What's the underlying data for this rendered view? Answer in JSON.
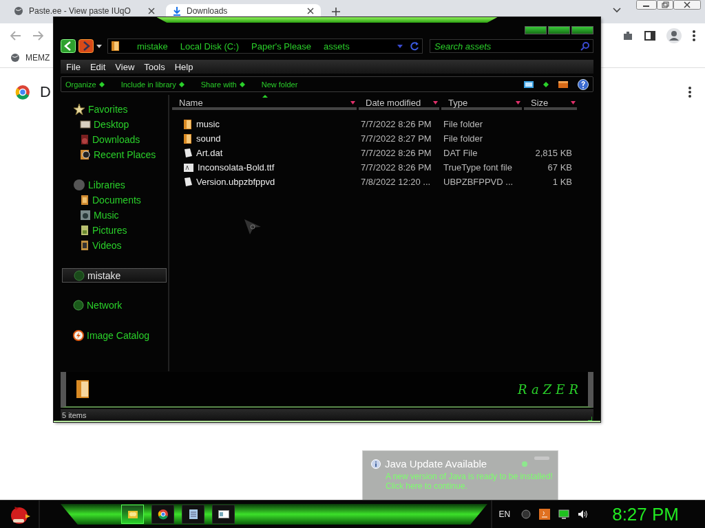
{
  "browser": {
    "tabs": [
      {
        "title": "Paste.ee - View paste IUqO",
        "selected": false
      },
      {
        "title": "Downloads",
        "selected": true
      }
    ],
    "bookmarks": [
      {
        "label": "MEMZ"
      }
    ],
    "page_heading": "D"
  },
  "explorer": {
    "breadcrumb": [
      "mistake",
      "Local Disk (C:)",
      "Paper's Please",
      "assets"
    ],
    "search": {
      "placeholder": "Search assets"
    },
    "menu": [
      "File",
      "Edit",
      "View",
      "Tools",
      "Help"
    ],
    "commands": [
      "Organize",
      "Include in library",
      "Share with",
      "New folder"
    ],
    "nav": [
      {
        "label": "Favorites",
        "kind": "favorites",
        "selected": false,
        "children": [
          {
            "label": "Desktop",
            "kind": "desktop",
            "selected": false
          },
          {
            "label": "Downloads",
            "kind": "downloads",
            "selected": false
          },
          {
            "label": "Recent Places",
            "kind": "recent",
            "selected": false
          }
        ]
      },
      {
        "label": "Libraries",
        "kind": "libraries",
        "selected": false,
        "children": [
          {
            "label": "Documents",
            "kind": "documents",
            "selected": false
          },
          {
            "label": "Music",
            "kind": "music",
            "selected": false
          },
          {
            "label": "Pictures",
            "kind": "pictures",
            "selected": false
          },
          {
            "label": "Videos",
            "kind": "videos",
            "selected": false
          }
        ]
      },
      {
        "label": "mistake",
        "kind": "user",
        "selected": true
      },
      {
        "label": "Network",
        "kind": "network",
        "selected": false
      },
      {
        "label": "Image Catalog",
        "kind": "catalog",
        "selected": false
      }
    ],
    "columns": [
      "Name",
      "Date modified",
      "Type",
      "Size"
    ],
    "rows": [
      {
        "name": "music",
        "kind": "folder",
        "date": "7/7/2022 8:26 PM",
        "type": "File folder"
      },
      {
        "name": "sound",
        "kind": "folder",
        "date": "7/7/2022 8:27 PM",
        "type": "File folder"
      },
      {
        "name": "Art.dat",
        "kind": "file",
        "date": "7/7/2022 8:26 PM",
        "type": "DAT File",
        "size": "2,815 KB"
      },
      {
        "name": "Inconsolata-Bold.ttf",
        "kind": "font",
        "date": "7/7/2022 8:26 PM",
        "type": "TrueType font file",
        "size": "67 KB"
      },
      {
        "name": "Version.ubpzbfppvd",
        "kind": "file",
        "date": "7/8/2022 12:20 ...",
        "type": "UBPZBFPPVD ...",
        "size": "1 KB"
      }
    ],
    "logo": "RaZER",
    "status": "5 items"
  },
  "notification": {
    "title": "Java Update Available",
    "lines": [
      "A new version of Java is ready to be installed!",
      "Click here to continue."
    ]
  },
  "taskbar": {
    "apps": [
      {
        "kind": "explorer",
        "selected": true
      },
      {
        "kind": "chrome",
        "selected": false
      },
      {
        "kind": "notepad",
        "selected": false
      },
      {
        "kind": "window",
        "selected": false
      }
    ],
    "language": "EN",
    "clock": "8:27 PM"
  }
}
